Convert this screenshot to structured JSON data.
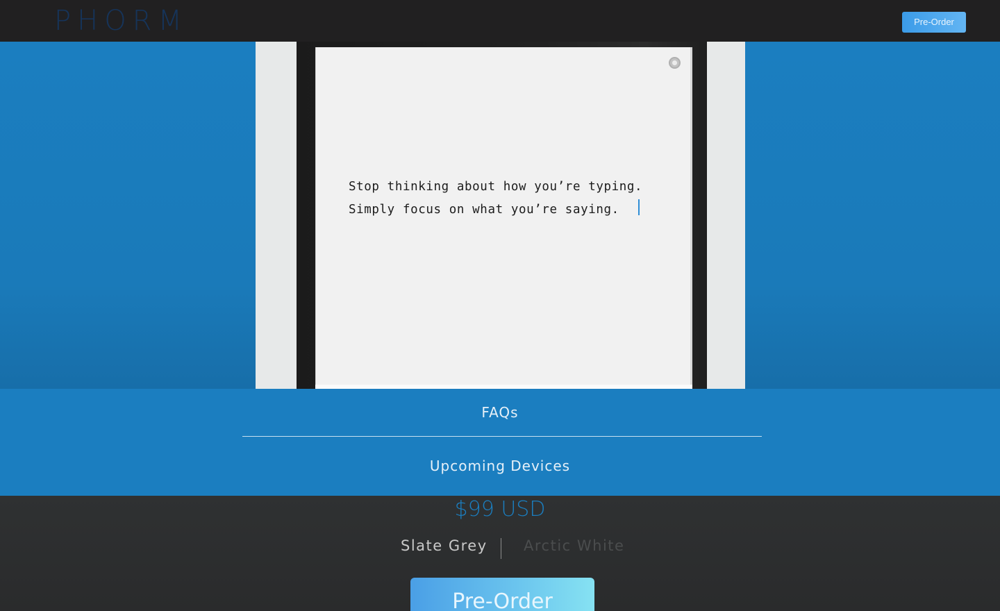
{
  "header": {
    "logo": "PHORM",
    "preorder_label": "Pre-Order"
  },
  "hero": {
    "line1": "Stop thinking about how you’re typing.",
    "line2": "Simply focus on what you’re saying."
  },
  "links": {
    "faqs": "FAQs",
    "upcoming": "Upcoming Devices"
  },
  "purchase": {
    "price": "$99 USD",
    "options": [
      "Slate Grey",
      "Arctic White"
    ],
    "selected": "Slate Grey",
    "preorder_label": "Pre-Order"
  },
  "colors": {
    "accent": "#1b7ec0",
    "topbar": "#212021",
    "button": "#3b9be8"
  },
  "icons": {
    "settings": "settings-icon"
  }
}
